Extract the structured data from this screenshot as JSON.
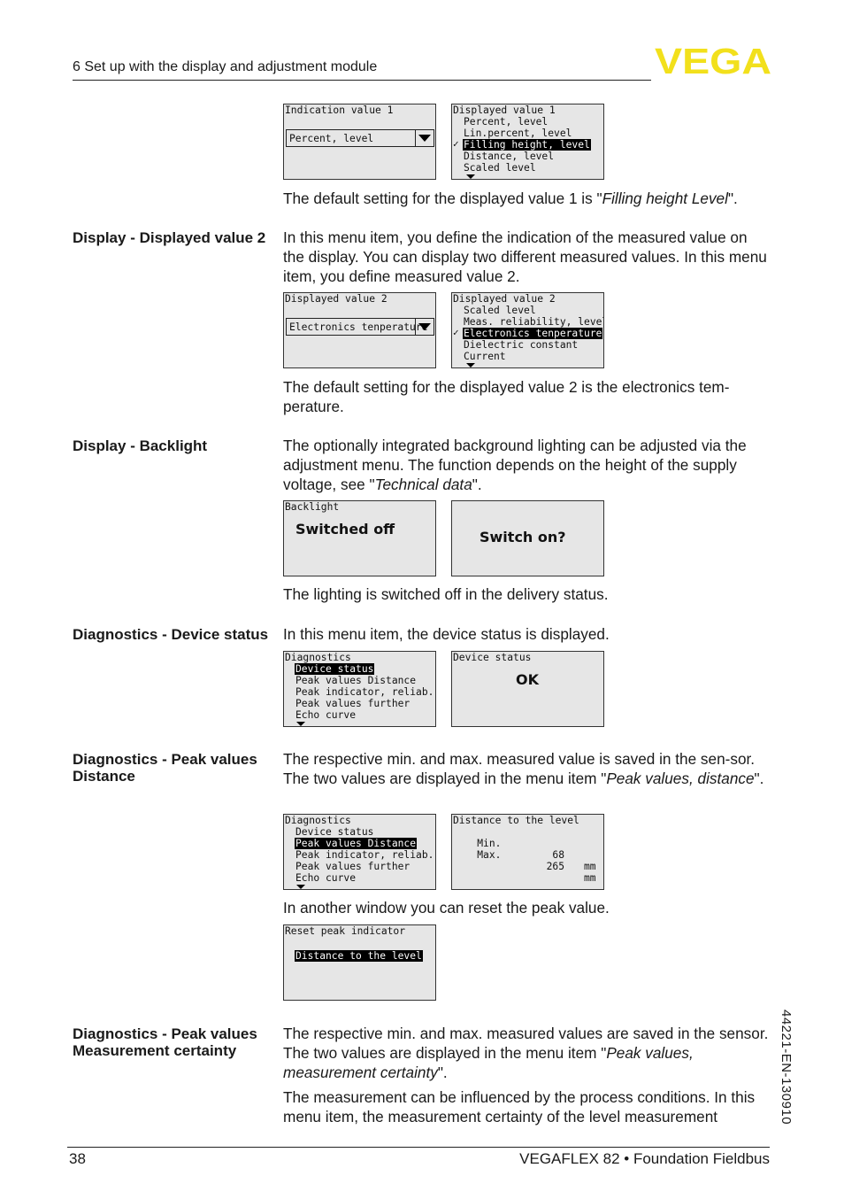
{
  "header": {
    "section_title": "6 Set up with the display and adjustment module",
    "logo_text": "VEGA",
    "brand_color": "#f2e01c"
  },
  "sections": [
    {
      "id": "displayed-value-1-tail",
      "screens": [
        {
          "title": "Indication value 1",
          "type": "dropdown",
          "value": "Percent, level"
        },
        {
          "title": "Displayed value 1",
          "type": "list",
          "items": [
            "Percent, level",
            "Lin.percent, level",
            "Filling height, level",
            "Distance, level",
            "Scaled level"
          ],
          "selected": "Filling height, level",
          "more": true
        }
      ],
      "note_pre": "The default setting for the displayed value 1 is \"",
      "note_italic": "Filling height Level",
      "note_post": "\"."
    },
    {
      "id": "displayed-value-2",
      "label": "Display - Displayed value 2",
      "text": "In this menu item, you define the indication of the measured value on the display. You can display two different measured values. In this menu item, you define measured value 2.",
      "screens": [
        {
          "title": "Displayed value 2",
          "type": "dropdown",
          "value": "Electronics tenperature"
        },
        {
          "title": "Displayed value 2",
          "type": "list",
          "items": [
            "Scaled level",
            "Meas. reliability, level",
            "Electronics tenperature",
            "Dielectric constant",
            "Current"
          ],
          "selected": "Electronics tenperature",
          "more": true
        }
      ],
      "note": "The default setting for the displayed value 2 is the electronics tem-perature."
    },
    {
      "id": "backlight",
      "label": "Display - Backlight",
      "text_pre": "The optionally integrated background lighting can be adjusted via the adjustment menu. The function depends on the height of the supply voltage, see \"",
      "text_italic": "Technical data",
      "text_post": "\".",
      "screens": [
        {
          "title": "Backlight",
          "value": "Switched off"
        },
        {
          "title": "",
          "value": "Switch on?"
        }
      ],
      "note": "The lighting is switched off in the delivery status."
    },
    {
      "id": "device-status",
      "label": "Diagnostics - Device status",
      "text": "In this menu item, the device status is displayed.",
      "screens": [
        {
          "title": "Diagnostics",
          "type": "list",
          "items": [
            "Device status",
            "Peak values Distance",
            "Peak indicator, reliab.",
            "Peak values further",
            "Echo curve"
          ],
          "selected": "Device status",
          "more": true
        },
        {
          "title": "Device status",
          "value": "OK"
        }
      ]
    },
    {
      "id": "peak-distance",
      "label": "Diagnostics - Peak values Distance",
      "text_pre": "The respective min. and max. measured value is saved in the sen-sor. The two values are displayed in the menu item \"",
      "text_italic": "Peak values, distance",
      "text_post": "\".",
      "screens": [
        {
          "title": "Diagnostics",
          "type": "list",
          "items": [
            "Device status",
            "Peak values Distance",
            "Peak indicator, reliab.",
            "Peak values further",
            "Echo curve"
          ],
          "selected": "Peak values Distance",
          "more": true
        },
        {
          "title": "Distance to the level",
          "rows": [
            {
              "label": "Min.",
              "value": "68",
              "unit": "mm"
            },
            {
              "label": "Max.",
              "value": "265",
              "unit": "mm"
            }
          ]
        }
      ],
      "note": "In another window you can reset the peak value.",
      "reset_screen": {
        "title": "Reset peak indicator",
        "selected": "Distance to the level"
      }
    },
    {
      "id": "peak-certainty",
      "label": "Diagnostics - Peak values Measurement certainty",
      "text_pre": "The respective min. and max. measured values are saved in the sensor. The two values are displayed in the menu item \"",
      "text_italic": "Peak values, measurement certainty",
      "text_post": "\".",
      "text2": "The measurement can be influenced by the process conditions. In this menu item, the measurement certainty of the level measurement"
    }
  ],
  "footer": {
    "page_number": "38",
    "doc_title": "VEGAFLEX 82 • Foundation Fieldbus",
    "doc_id": "44221-EN-130910"
  }
}
